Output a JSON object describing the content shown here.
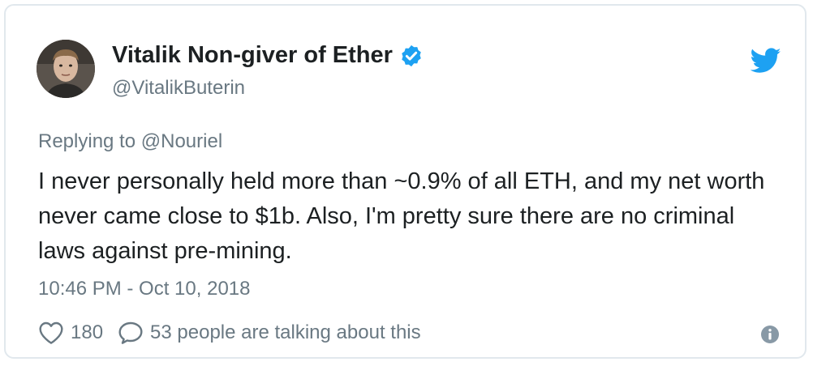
{
  "author": {
    "display_name": "Vitalik Non-giver of Ether",
    "handle": "@VitalikButerin",
    "verified": true
  },
  "reply": {
    "prefix": "Replying to",
    "mention": "@Nouriel"
  },
  "tweet": {
    "text": "I never personally held more than ~0.9% of all ETH, and my net worth never came close to $1b. Also, I'm pretty sure there are no criminal laws against pre-mining.",
    "timestamp": "10:46 PM - Oct 10, 2018"
  },
  "actions": {
    "likes": "180",
    "conversation": "53 people are talking about this"
  },
  "icons": {
    "verified": "verified-badge-icon",
    "brand": "twitter-bird-icon",
    "like": "heart-icon",
    "reply": "speech-bubble-icon",
    "info": "info-icon"
  },
  "colors": {
    "brand_blue": "#1da1f2",
    "text_primary": "#1c2022",
    "text_secondary": "#697882",
    "border": "#e1e8ed"
  }
}
